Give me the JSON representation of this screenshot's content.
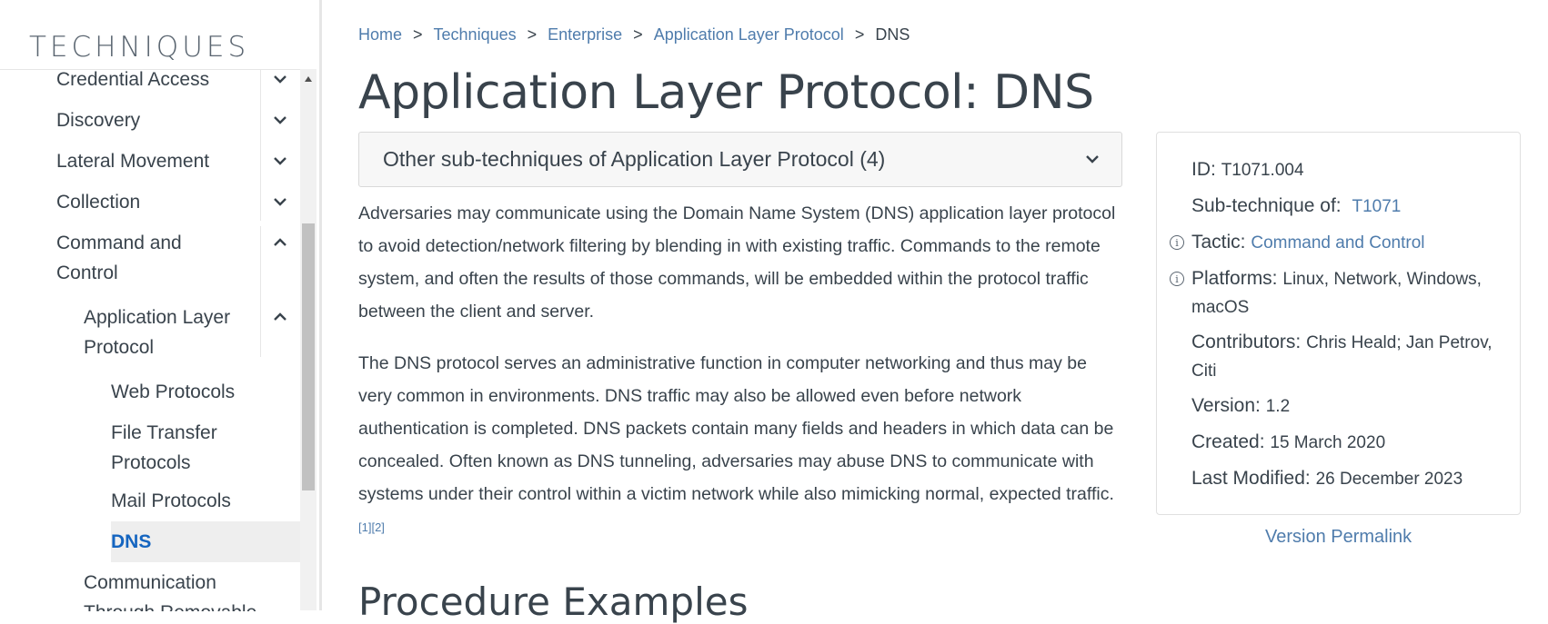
{
  "sidebar": {
    "title": "TECHNIQUES",
    "items": [
      {
        "label": "Credential Access",
        "expanded": false
      },
      {
        "label": "Discovery",
        "expanded": false
      },
      {
        "label": "Lateral Movement",
        "expanded": false
      },
      {
        "label": "Collection",
        "expanded": false
      },
      {
        "label_line1": "Command and",
        "label_line2": "Control",
        "expanded": true
      },
      {
        "label_line1": "Application Layer",
        "label_line2": "Protocol",
        "expanded": true
      },
      {
        "label": "Web Protocols"
      },
      {
        "label_line1": "File Transfer",
        "label_line2": "Protocols"
      },
      {
        "label": "Mail Protocols"
      },
      {
        "label": "DNS",
        "active": true
      },
      {
        "label_line1": "Communication",
        "label_line2": "Through Removable"
      }
    ]
  },
  "breadcrumb": {
    "items": [
      "Home",
      "Techniques",
      "Enterprise",
      "Application Layer Protocol"
    ],
    "current": "DNS",
    "separator": ">"
  },
  "page": {
    "title": "Application Layer Protocol: DNS",
    "subtechniques_label": "Other sub-techniques of Application Layer Protocol (4)",
    "paragraph1": "Adversaries may communicate using the Domain Name System (DNS) application layer protocol to avoid detection/network filtering by blending in with existing traffic. Commands to the remote system, and often the results of those commands, will be embedded within the protocol traffic between the client and server.",
    "paragraph2": "The DNS protocol serves an administrative function in computer networking and thus may be very common in environments. DNS traffic may also be allowed even before network authentication is completed. DNS packets contain many fields and headers in which data can be concealed. Often known as DNS tunneling, adversaries may abuse DNS to communicate with systems under their control within a victim network while also mimicking normal, expected traffic.",
    "cite1": "[1]",
    "cite2": "[2]",
    "procedure_heading": "Procedure Examples"
  },
  "card": {
    "id_label": "ID:",
    "id_value": "T1071.004",
    "subtech_label": "Sub-technique of:",
    "subtech_value": "T1071",
    "tactic_label": "Tactic:",
    "tactic_value": "Command and Control",
    "platforms_label": "Platforms:",
    "platforms_value": "Linux, Network, Windows, macOS",
    "contributors_label": "Contributors:",
    "contributors_value": "Chris Heald; Jan Petrov, Citi",
    "version_label": "Version:",
    "version_value": "1.2",
    "created_label": "Created:",
    "created_value": "15 March 2020",
    "modified_label": "Last Modified:",
    "modified_value": "26 December 2023",
    "info_glyph": "i"
  },
  "permalink": "Version Permalink",
  "colors": {
    "link": "#4f7cac",
    "active": "#1565c0",
    "text": "#39434c"
  }
}
